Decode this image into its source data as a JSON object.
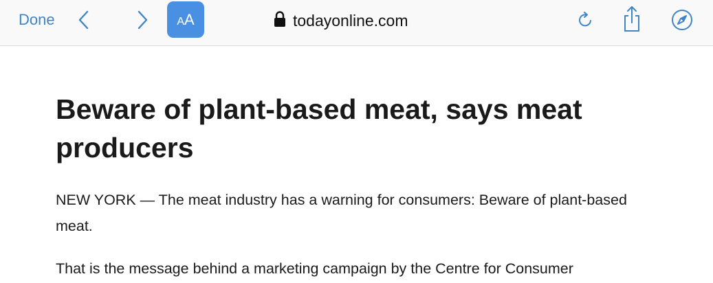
{
  "toolbar": {
    "done_label": "Done",
    "reader_label_big": "A",
    "reader_label_small": "A",
    "address": "todayonline.com",
    "accent_color": "#3d85c6",
    "reader_button_color": "#4a90e2",
    "icons": [
      "chevron-left-icon",
      "chevron-right-icon",
      "lock-icon",
      "reload-icon",
      "share-icon",
      "compass-icon"
    ]
  },
  "article": {
    "headline": "Beware of plant-based meat, says meat producers",
    "paragraphs": [
      "NEW YORK — The meat industry has a warning for consumers: Beware of plant-based meat.",
      "That is the message behind a marketing campaign by the Centre for Consumer"
    ]
  }
}
